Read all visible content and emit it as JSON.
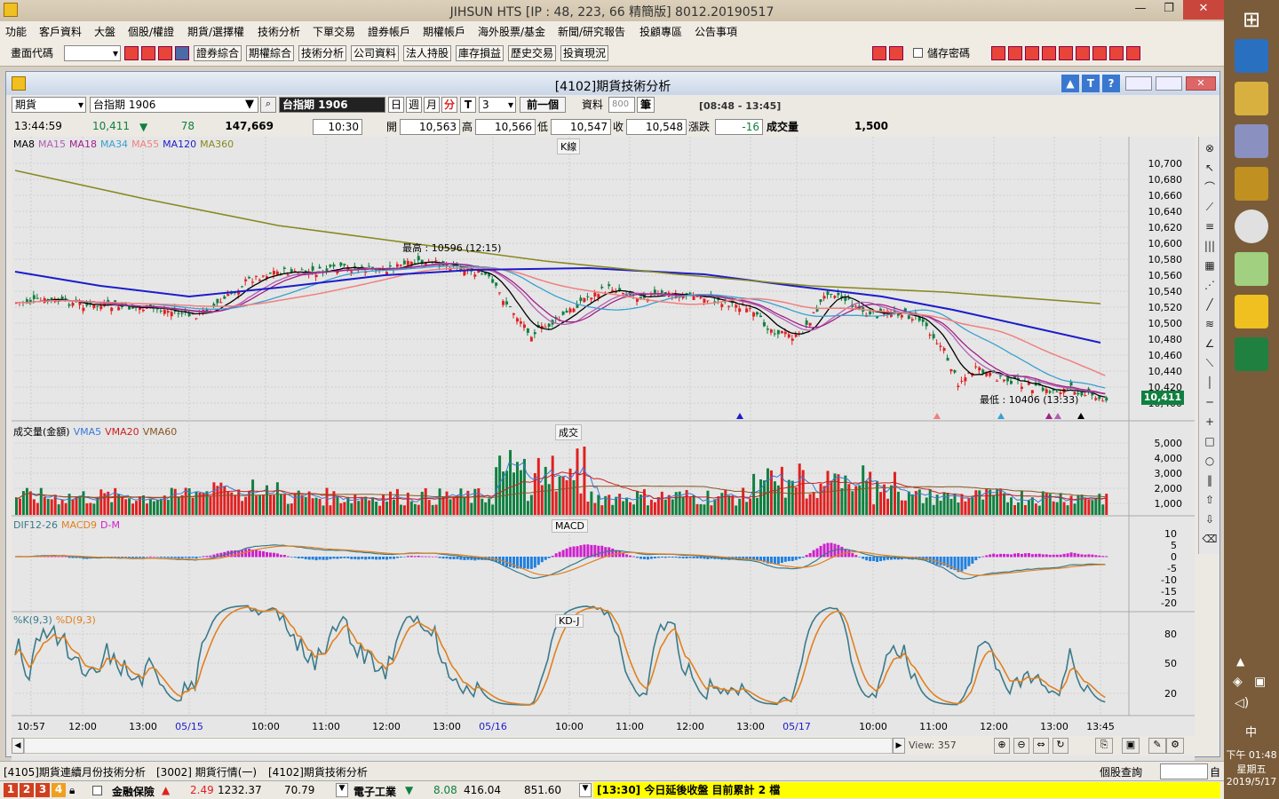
{
  "window": {
    "title": "JIHSUN HTS  [IP : 48, 223, 66 精簡版] 8012.20190517",
    "min": "—",
    "max": "❐",
    "close": "✕"
  },
  "menu": [
    "功能",
    "客戶資料",
    "大盤",
    "個股/權證",
    "期貨/選擇權",
    "技術分析",
    "下單交易",
    "證券帳戶",
    "期權帳戶",
    "海外股票/基金",
    "新聞/研究報告",
    "投顧專區",
    "公告事項"
  ],
  "toolbar": {
    "code_label": "畫面代碼",
    "buttons": [
      "證券綜合",
      "期權綜合",
      "技術分析",
      "公司資料",
      "法人持股",
      "庫存損益",
      "歷史交易",
      "投資現況"
    ],
    "save_pw_label": "儲存密碼"
  },
  "child": {
    "title": "[4102]期貨技術分析",
    "btn_up": "▲",
    "btn_t": "T",
    "btn_help": "?"
  },
  "ctl": {
    "type_value": "期貨",
    "symbol_value": "台指期 1906",
    "symbol_name": "台指期 1906",
    "p_day": "日",
    "p_week": "週",
    "p_month": "月",
    "p_min": "分",
    "t_label": "T",
    "t_value": "3",
    "prev_btn": "前一個",
    "data_label": "資料",
    "data_count": "800",
    "data_unit": "筆",
    "session": "[08:48 - 13:45]"
  },
  "quote": {
    "time": "13:44:59",
    "last": "10,411",
    "arrow": "▼",
    "change": "78",
    "volume_total": "147,669",
    "bar_time": "10:30",
    "open_label": "開",
    "open": "10,563",
    "high_label": "高",
    "high": "10,566",
    "low_label": "低",
    "low": "10,547",
    "close_label": "收",
    "close": "10,548",
    "chg_label": "漲跌",
    "chg": "-16",
    "vol_label": "成交量",
    "vol": "1,500"
  },
  "panels": {
    "k_title": "K線",
    "vol_title": "成交",
    "macd_title": "MACD",
    "kd_title": "KD-J",
    "ma_legend": [
      {
        "t": "MA8",
        "c": "#000000"
      },
      {
        "t": "MA15",
        "c": "#b060b0"
      },
      {
        "t": "MA18",
        "c": "#a0208c"
      },
      {
        "t": "MA34",
        "c": "#3aa0d0"
      },
      {
        "t": "MA55",
        "c": "#f08080"
      },
      {
        "t": "MA120",
        "c": "#1c1ccc"
      },
      {
        "t": "MA360",
        "c": "#888820"
      }
    ],
    "vol_legend": [
      {
        "t": "成交量(金額)",
        "c": "#000000"
      },
      {
        "t": "VMA5",
        "c": "#3a7ad8"
      },
      {
        "t": "VMA20",
        "c": "#cc2020"
      },
      {
        "t": "VMA60",
        "c": "#885522"
      }
    ],
    "macd_legend": [
      {
        "t": "DIF12-26",
        "c": "#3a7a8a"
      },
      {
        "t": "MACD9",
        "c": "#e08020"
      },
      {
        "t": "D-M",
        "c": "#cc20cc"
      }
    ],
    "kd_legend": [
      {
        "t": "%K(9,3)",
        "c": "#3a7a8a"
      },
      {
        "t": "%D(9,3)",
        "c": "#e08020"
      }
    ],
    "high_note": "最高 : 10596 (12:15)",
    "low_note": "最低 : 10406 (13:33)",
    "last_tag": "10,411",
    "price_ticks": [
      "10,700",
      "10,680",
      "10,660",
      "10,640",
      "10,620",
      "10,600",
      "10,580",
      "10,560",
      "10,540",
      "10,520",
      "10,500",
      "10,480",
      "10,460",
      "10,440",
      "10,420",
      "10,400"
    ],
    "vol_ticks": [
      "5,000",
      "4,000",
      "3,000",
      "2,000",
      "1,000"
    ],
    "macd_ticks": [
      "10",
      "5",
      "0",
      "-5",
      "-10",
      "-15",
      "-20"
    ],
    "kd_ticks": [
      "80",
      "50",
      "20"
    ],
    "time_ticks": [
      "10:57",
      "12:00",
      "13:00",
      "05/15",
      "10:00",
      "11:00",
      "12:00",
      "13:00",
      "05/16",
      "10:00",
      "11:00",
      "12:00",
      "13:00",
      "05/17",
      "10:00",
      "11:00",
      "12:00",
      "13:00",
      "13:45"
    ],
    "view_label": "View: 357"
  },
  "tabs": [
    "[4105]期貨連續月份技術分析",
    "[3002] 期貨行情(一)",
    "[4102]期貨技術分析"
  ],
  "stock_query": "個股查詢",
  "status": {
    "nums": [
      "1",
      "2",
      "3",
      "4"
    ],
    "sec1": "金融保險",
    "sec1_arrow": "▲",
    "sec1_chg": "2.49",
    "sec1_idx": "1232.37",
    "sec1_v": "70.79",
    "sec2": "電子工業",
    "sec2_arrow": "▼",
    "sec2_chg": "8.08",
    "sec2_idx": "416.04",
    "sec2_v": "851.60",
    "ticker": "[13:30] 今日延後收盤 目前累計 2 檔"
  },
  "clock": {
    "time": "下午 01:48",
    "weekday": "星期五",
    "date": "2019/5/17",
    "ime": "中"
  },
  "colors": {
    "up": "#e02020",
    "down": "#108040",
    "accent": "#1c1ccc"
  }
}
